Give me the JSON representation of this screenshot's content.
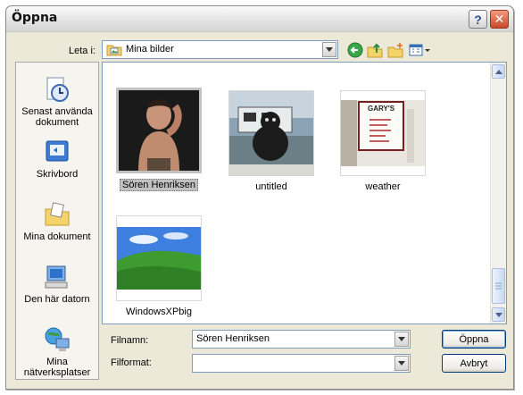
{
  "window": {
    "title": "Öppna"
  },
  "titlebar": {
    "help_label": "?",
    "close_label": "✕"
  },
  "lookin": {
    "label": "Leta i:",
    "value": "Mina bilder"
  },
  "toolbar": {
    "icons": [
      "back-icon",
      "up-folder-icon",
      "new-folder-icon",
      "views-menu-icon"
    ]
  },
  "places": [
    {
      "label": "Senast använda dokument",
      "icon": "recent-documents-icon"
    },
    {
      "label": "Skrivbord",
      "icon": "desktop-icon"
    },
    {
      "label": "Mina dokument",
      "icon": "my-documents-icon"
    },
    {
      "label": "Den här datorn",
      "icon": "my-computer-icon"
    },
    {
      "label": "Mina nätverksplatser",
      "icon": "network-places-icon"
    }
  ],
  "files": [
    {
      "name": "Sören Henriksen",
      "selected": true
    },
    {
      "name": "untitled"
    },
    {
      "name": "weather"
    },
    {
      "name": "WindowsXPbig"
    }
  ],
  "weather_sign": {
    "title": "GARY'S"
  },
  "filename": {
    "label": "Filnamn:",
    "value": "Sören Henriksen"
  },
  "filetype": {
    "label": "Filformat:",
    "value": ""
  },
  "buttons": {
    "open": "Öppna",
    "cancel": "Avbryt"
  },
  "colors": {
    "title_bar": "#e2e2e2",
    "dialog_bg": "#ece9d8",
    "field_border": "#7f9db9",
    "close_button": "#c84a2c"
  }
}
